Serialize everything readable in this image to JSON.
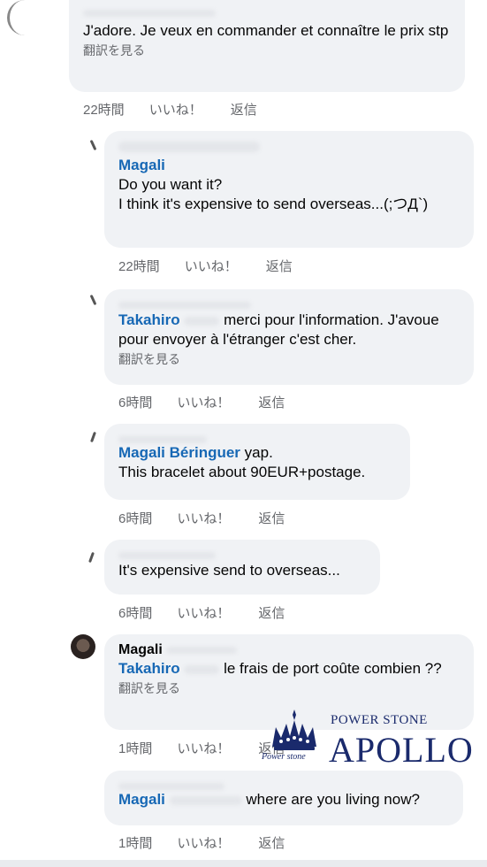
{
  "comments": [
    {
      "id": "c1",
      "text": "J'adore. Je veux en commander et connaître le prix stp",
      "translate": "翻訳を見る",
      "time": "22時間",
      "like": "いいね！",
      "reply": "返信"
    },
    {
      "id": "c2",
      "mention": "Magali",
      "text1": "Do you want it?",
      "text2": "I think it's expensive to send overseas...(;つД`)",
      "time": "22時間",
      "like": "いいね！",
      "reply": "返信"
    },
    {
      "id": "c3",
      "mention": "Takahiro",
      "text": "merci pour l'information. J'avoue pour envoyer à l'étranger c'est cher.",
      "translate": "翻訳を見る",
      "time": "6時間",
      "like": "いいね！",
      "reply": "返信"
    },
    {
      "id": "c4",
      "mention": "Magali Béringuer",
      "text1": "yap.",
      "text2": "This bracelet about 90EUR+postage.",
      "time": "6時間",
      "like": "いいね！",
      "reply": "返信"
    },
    {
      "id": "c5",
      "text": "It's expensive send to overseas...",
      "time": "6時間",
      "like": "いいね！",
      "reply": "返信"
    },
    {
      "id": "c6",
      "author": "Magali",
      "mention": "Takahiro",
      "text": "le frais de port coûte combien ??",
      "translate": "翻訳を見る",
      "time": "1時間",
      "like": "いいね！",
      "reply": "返信"
    },
    {
      "id": "c7",
      "mention": "Magali",
      "text": "where are you living now?",
      "time": "1時間",
      "like": "いいね！",
      "reply": "返信"
    }
  ],
  "watermark": {
    "line1": "POWER STONE",
    "line2": "APOLLO",
    "line3": "Power stone"
  },
  "colors": {
    "bubble": "#f0f2f5",
    "mention": "#1768b5",
    "meta": "#65676b",
    "logo": "#1a2a6c"
  }
}
